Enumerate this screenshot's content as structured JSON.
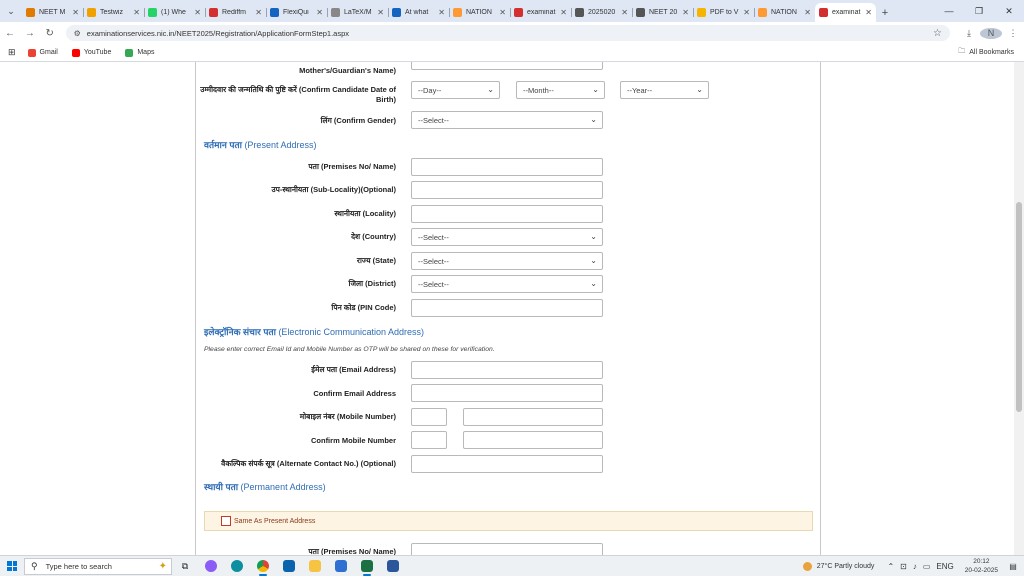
{
  "browser": {
    "tabs": [
      {
        "label": "NEET M",
        "color": "#e07b00"
      },
      {
        "label": "Testwiz",
        "color": "#f0a000"
      },
      {
        "label": "(1) Whe",
        "color": "#25d366"
      },
      {
        "label": "Rediffm",
        "color": "#d32f2f"
      },
      {
        "label": "FlexiQui",
        "color": "#1565c0"
      },
      {
        "label": "LaTeX/M",
        "color": "#888888"
      },
      {
        "label": "At what",
        "color": "#1565c0"
      },
      {
        "label": "NATION",
        "color": "#ff9933"
      },
      {
        "label": "examinat",
        "color": "#d32f2f"
      },
      {
        "label": "2025020",
        "color": "#555555"
      },
      {
        "label": "NEET 20",
        "color": "#555555"
      },
      {
        "label": "PDF to V",
        "color": "#f4b400"
      },
      {
        "label": "NATION",
        "color": "#ff9933"
      },
      {
        "label": "examinat",
        "color": "#d32f2f"
      }
    ],
    "url": "examinationservices.nic.in/NEET2025/Registration/ApplicationFormStep1.aspx",
    "avatar_initial": "N",
    "bookmarks": [
      {
        "label": "Gmail",
        "color": "#ea4335"
      },
      {
        "label": "YouTube",
        "color": "#ff0000"
      },
      {
        "label": "Maps",
        "color": "#34a853"
      }
    ],
    "all_bookmarks": "All Bookmarks"
  },
  "form": {
    "mother_label": "Mother's/Guardian's Name)",
    "dob_label": "उम्मीदवार की जन्मतिथि की पुष्टि करें (Confirm Candidate Date of Birth)",
    "dob_day": "--Day--",
    "dob_month": "--Month--",
    "dob_year": "--Year--",
    "gender_label": "लिंग (Confirm Gender)",
    "gender_value": "--Select--",
    "present": {
      "heading_hi": "वर्तमान पता",
      "heading_en": "(Present Address)",
      "premises_label": "पता (Premises No/ Name)",
      "sublocality_label": "उप-स्थानीयता (Sub-Locality)(Optional)",
      "locality_label": "स्थानीयता (Locality)",
      "country_label": "देश (Country)",
      "country_value": "--Select--",
      "state_label": "राज्य (State)",
      "state_value": "--Select--",
      "district_label": "जिला (District)",
      "district_value": "--Select--",
      "pin_label": "पिन कोड (PIN Code)"
    },
    "electronic": {
      "heading_hi": "इलेक्ट्रॉनिक संचार पता",
      "heading_en": "(Electronic Communication Address)",
      "note": "Please enter correct Email Id and Mobile Number as OTP will be shared on these for verification.",
      "email_label": "ईमेल पता (Email Address)",
      "confirm_email_label": "Confirm Email Address",
      "mobile_label": "मोबाइल नंबर (Mobile Number)",
      "confirm_mobile_label": "Confirm Mobile Number",
      "alternate_label": "वैकल्पिक संपर्क सूत्र (Alternate Contact No.) (Optional)"
    },
    "permanent": {
      "heading_hi": "स्थायी पता",
      "heading_en": "(Permanent Address)",
      "same_as_present": "Same As Present Address",
      "premises_label": "पता (Premises No/ Name)"
    }
  },
  "taskbar": {
    "search_placeholder": "Type here to search",
    "weather": "27°C  Partly cloudy",
    "language": "ENG",
    "time": "20:12",
    "date": "20-02-2025"
  }
}
